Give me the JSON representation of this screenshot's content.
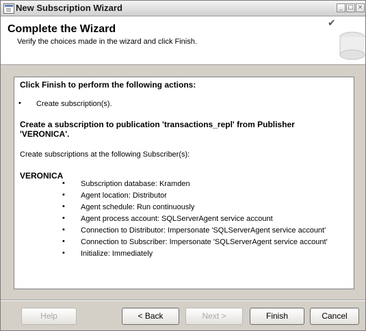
{
  "window": {
    "title": "New Subscription Wizard",
    "controls": {
      "minimize_icon": "minimize-icon",
      "maximize_icon": "maximize-icon",
      "close_icon": "close-icon"
    }
  },
  "header": {
    "title": "Complete the Wizard",
    "subtitle": "Verify the choices made in the wizard and click Finish."
  },
  "summary": {
    "heading1": "Click Finish to perform the following actions:",
    "actions": [
      "Create subscription(s)."
    ],
    "heading2_line1": "Create a subscription to publication 'transactions_repl' from Publisher",
    "heading2_line2": "'VERONICA'.",
    "subscribers_label": "Create subscriptions at the following Subscriber(s):",
    "subscriber_name": "VERONICA",
    "details": [
      "Subscription database: Kramden",
      "Agent location: Distributor",
      "Agent schedule: Run continuously",
      "Agent process account: SQLServerAgent service account",
      "Connection to Distributor: Impersonate 'SQLServerAgent service account'",
      "Connection to Subscriber: Impersonate 'SQLServerAgent service account'",
      "Initialize: Immediately"
    ],
    "bullet_glyph": "•"
  },
  "buttons": {
    "help": "Help",
    "back": "< Back",
    "next": "Next >",
    "finish": "Finish",
    "cancel": "Cancel"
  }
}
